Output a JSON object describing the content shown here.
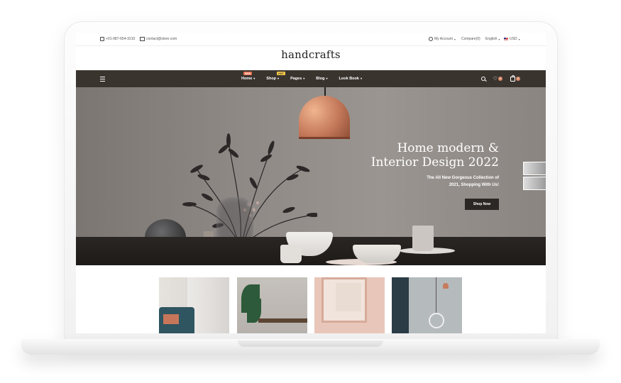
{
  "topbar": {
    "phone": "+01-987-654-3210",
    "email": "contact@store.com",
    "account": "My Account",
    "compare": "Compare(0)",
    "language": "English",
    "currency": "USD"
  },
  "logo": "handcrafts",
  "nav": {
    "items": [
      {
        "label": "Home",
        "badge": "NEW"
      },
      {
        "label": "Shop",
        "badge": "HOT"
      },
      {
        "label": "Pages",
        "badge": ""
      },
      {
        "label": "Blog",
        "badge": ""
      },
      {
        "label": "Look Book",
        "badge": ""
      }
    ],
    "wishlist_count": "0",
    "cart_count": "0"
  },
  "hero": {
    "title_line1": "Home modern &",
    "title_line2": "Interior Design 2022",
    "subtitle_line1": "The All New Gorgeous Collection of",
    "subtitle_line2": "2021, Shopping With Us!",
    "cta": "Shop Now"
  },
  "colors": {
    "nav_bg": "#3a342f",
    "accent": "#d9896a",
    "badge_new": "#e86f4f",
    "badge_hot": "#f7c948"
  }
}
